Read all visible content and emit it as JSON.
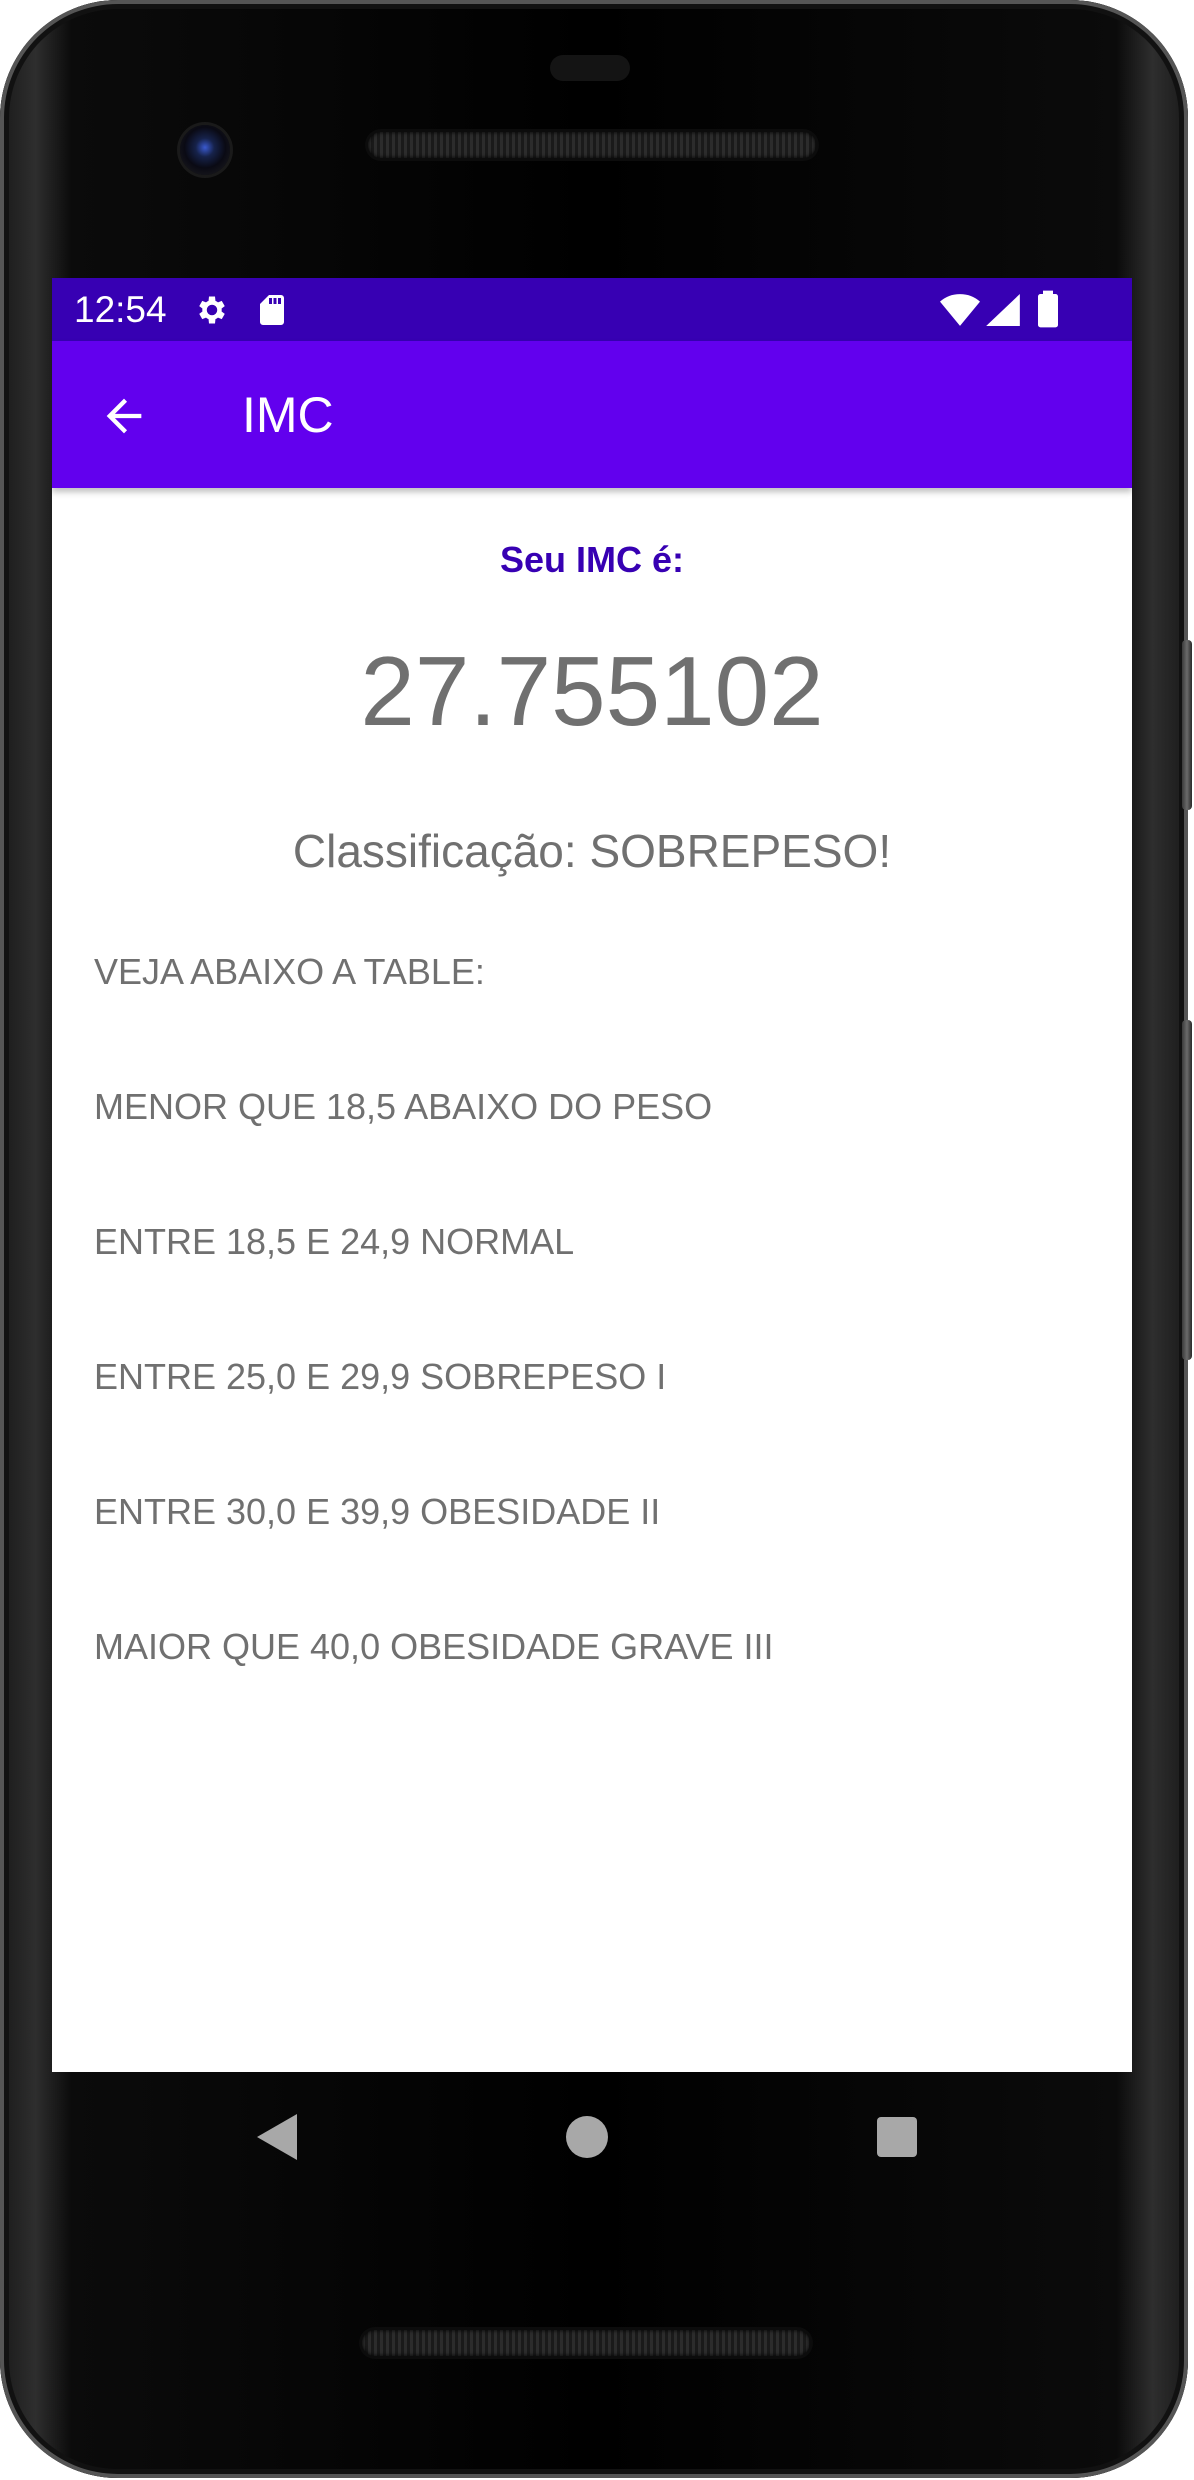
{
  "status_bar": {
    "time": "12:54",
    "icons": [
      "settings-icon",
      "sd-card-icon",
      "wifi-icon",
      "signal-icon",
      "battery-icon"
    ]
  },
  "app_bar": {
    "title": "IMC",
    "back_icon": "arrow-back-icon"
  },
  "result": {
    "label": "Seu IMC é:",
    "value": "27.755102",
    "classification": "Classificação: SOBREPESO!"
  },
  "table": {
    "header": "VEJA ABAIXO A TABLE:",
    "rows": [
      "MENOR QUE 18,5 ABAIXO DO PESO",
      "ENTRE 18,5 E 24,9 NORMAL",
      "ENTRE 25,0 E 29,9 SOBREPESO I",
      "ENTRE 30,0 E 39,9 OBESIDADE II",
      "MAIOR QUE 40,0 OBESIDADE GRAVE III"
    ]
  },
  "nav_bar": {
    "icons": [
      "back-triangle-icon",
      "home-circle-icon",
      "recents-square-icon"
    ]
  },
  "colors": {
    "status_bar": "#3700b3",
    "app_bar": "#6200ee",
    "accent_text": "#3700b3",
    "body_text": "#707070"
  }
}
